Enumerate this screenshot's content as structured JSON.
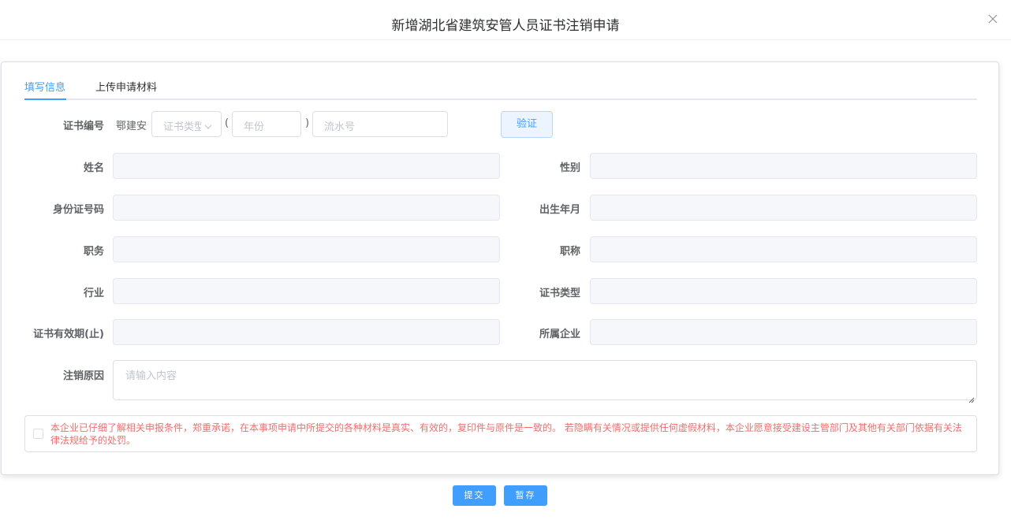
{
  "dialog": {
    "title": "新增湖北省建筑安管人员证书注销申请"
  },
  "tabs": [
    {
      "label": "填写信息",
      "active": true
    },
    {
      "label": "上传申请材料",
      "active": false
    }
  ],
  "cert_number": {
    "label": "证书编号",
    "prefix": "鄂建安",
    "type_placeholder": "证书类型",
    "open_paren": "(",
    "year_placeholder": "年份",
    "close_paren": ")",
    "serial_placeholder": "流水号",
    "verify_label": "验证"
  },
  "fields": {
    "name": "姓名",
    "gender": "性别",
    "id_number": "身份证号码",
    "birth": "出生年月",
    "position": "职务",
    "title": "职称",
    "industry": "行业",
    "cert_type": "证书类型",
    "validity": "证书有效期(止)",
    "company": "所属企业",
    "reason": "注销原因"
  },
  "reason_placeholder": "请输入内容",
  "commitment": "本企业已仔细了解相关申报条件，郑重承诺，在本事项申请中所提交的各种材料是真实、有效的，复印件与原件是一致的。 若隐瞒有关情况或提供任何虚假材料，本企业愿意接受建设主管部门及其他有关部门依据有关法律法规给予的处罚。",
  "footer": {
    "submit_label": "提交",
    "save_label": "暂存"
  },
  "colors": {
    "primary": "#409eff",
    "warning_text": "#f56c6c",
    "disabled_bg": "#f5f7fa"
  }
}
